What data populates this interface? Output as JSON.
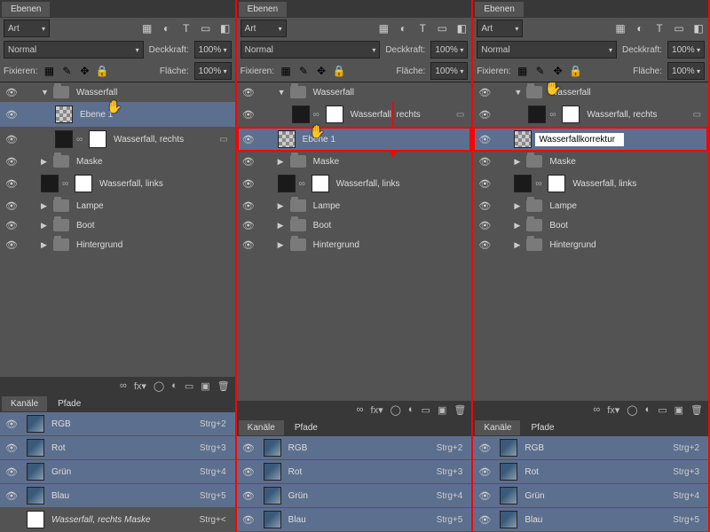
{
  "columns": [
    {
      "id": "col1",
      "layers_title": "Ebenen",
      "filter": "Art",
      "blend": "Normal",
      "opacity_label": "Deckkraft:",
      "opacity": "100%",
      "fix_label": "Fixieren:",
      "fill_label": "Fläche:",
      "fill": "100%",
      "folder_top": "Wasserfall",
      "layer_ebene": "Ebene 1",
      "layer_wf_r": "Wasserfall, rechts",
      "folder_maske": "Maske",
      "layer_wf_l": "Wasserfall, links",
      "folder_lampe": "Lampe",
      "folder_boot": "Boot",
      "folder_hg": "Hintergrund",
      "chan_tab1": "Kanäle",
      "chan_tab2": "Pfade",
      "chan_rgb": "RGB",
      "key_rgb": "Strg+2",
      "chan_r": "Rot",
      "key_r": "Strg+3",
      "chan_g": "Grün",
      "key_g": "Strg+4",
      "chan_b": "Blau",
      "key_b": "Strg+5",
      "chan_mask": "Wasserfall, rechts Maske",
      "key_mask": "Strg+<"
    },
    {
      "id": "col2",
      "layers_title": "Ebenen",
      "filter": "Art",
      "blend": "Normal",
      "opacity_label": "Deckkraft:",
      "opacity": "100%",
      "fix_label": "Fixieren:",
      "fill_label": "Fläche:",
      "fill": "100%",
      "folder_top": "Wasserfall",
      "layer_wf_r": "Wasserfall, rechts",
      "layer_ebene": "Ebene 1",
      "folder_maske": "Maske",
      "layer_wf_l": "Wasserfall, links",
      "folder_lampe": "Lampe",
      "folder_boot": "Boot",
      "folder_hg": "Hintergrund",
      "chan_tab1": "Kanäle",
      "chan_tab2": "Pfade",
      "chan_rgb": "RGB",
      "key_rgb": "Strg+2",
      "chan_r": "Rot",
      "key_r": "Strg+3",
      "chan_g": "Grün",
      "key_g": "Strg+4",
      "chan_b": "Blau",
      "key_b": "Strg+5"
    },
    {
      "id": "col3",
      "layers_title": "Ebenen",
      "filter": "Art",
      "blend": "Normal",
      "opacity_label": "Deckkraft:",
      "opacity": "100%",
      "fix_label": "Fixieren:",
      "fill_label": "Fläche:",
      "fill": "100%",
      "folder_top": "Wasserfall",
      "layer_wf_r": "Wasserfall, rechts",
      "rename_value": "Wasserfallkorrektur",
      "folder_maske": "Maske",
      "layer_wf_l": "Wasserfall, links",
      "folder_lampe": "Lampe",
      "folder_boot": "Boot",
      "folder_hg": "Hintergrund",
      "chan_tab1": "Kanäle",
      "chan_tab2": "Pfade",
      "chan_rgb": "RGB",
      "key_rgb": "Strg+2",
      "chan_r": "Rot",
      "key_r": "Strg+3",
      "chan_g": "Grün",
      "key_g": "Strg+4",
      "chan_b": "Blau",
      "key_b": "Strg+5"
    }
  ]
}
